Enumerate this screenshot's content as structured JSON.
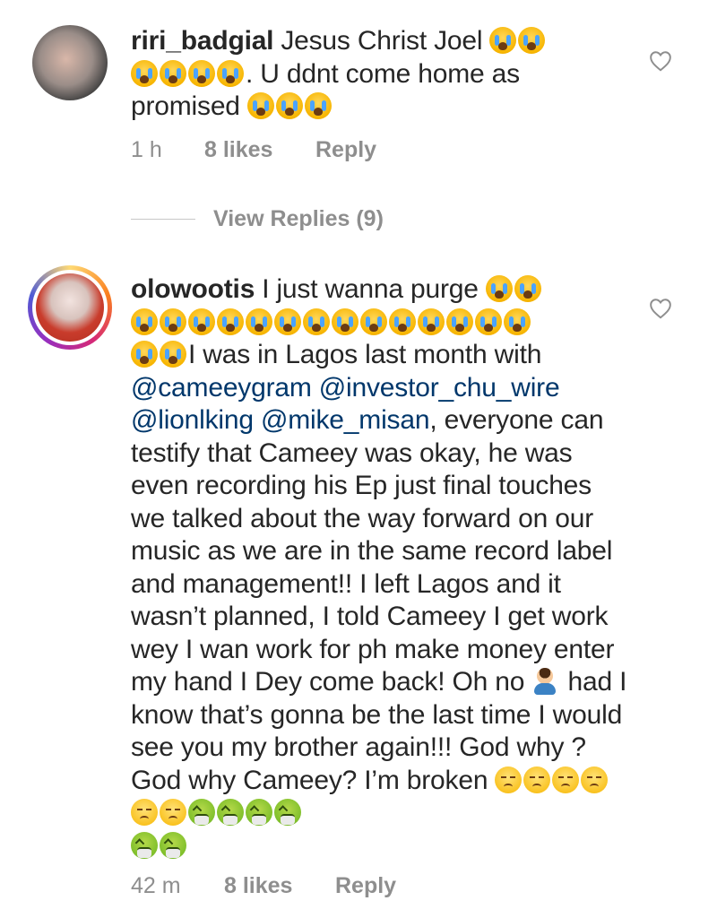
{
  "comments": [
    {
      "username": "riri_badgial",
      "text_lines": [
        "Jesus Christ Joel",
        ". U ddnt come home as",
        "promised"
      ],
      "time": "1 h",
      "likes": "8 likes",
      "reply": "Reply",
      "view_replies": "View Replies (9)"
    },
    {
      "username": "olowootis",
      "segments": {
        "s1": "I just wanna purge",
        "s2": "I was in Lagos last month with",
        "m1": "@cameeygram",
        "m2": "@investor_chu_wire",
        "m3": "@lionlking",
        "m4": "@mike_misan",
        "s3": ", everyone can testify that Cameey was okay, he was even recording his Ep just final touches we talked about the way forward on our music as we are in the same record label and management!! I left Lagos and it wasn’t planned, I told Cameey I get work wey I wan work for ph make money enter my hand I Dey come back! Oh no",
        "s4": "had I know that’s gonna be the last time I would see you my brother again!!! God why ? God why Cameey? I’m broken"
      },
      "time": "42 m",
      "likes": "8 likes",
      "reply": "Reply"
    }
  ],
  "icons": {
    "like": "heart-outline-icon",
    "crying": "loudly-crying-face-emoji",
    "disappointed": "disappointed-face-emoji",
    "nauseated": "face-vomiting-emoji",
    "facepalm": "person-facepalming-emoji"
  },
  "colors": {
    "text": "#262626",
    "meta": "#8e8e8e",
    "mention": "#00376b",
    "story_ring": "#d62976"
  }
}
